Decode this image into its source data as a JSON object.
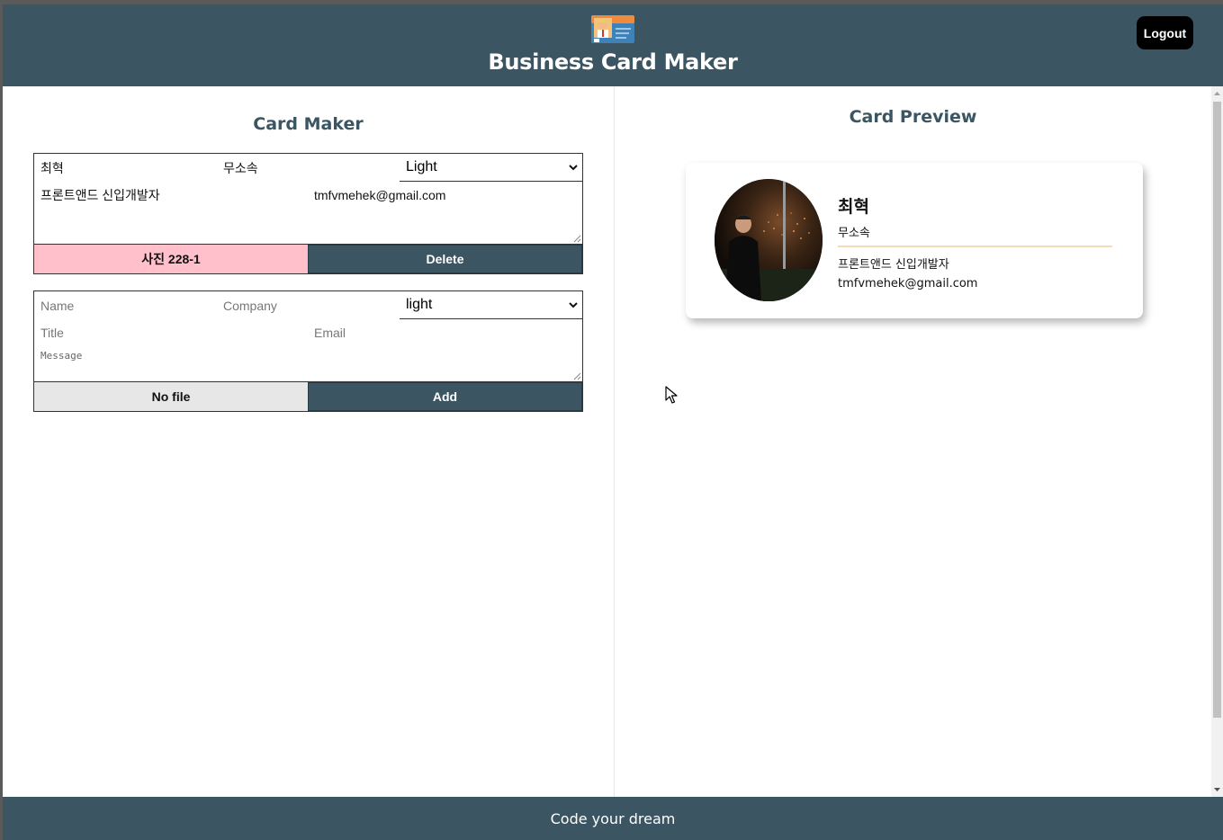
{
  "header": {
    "title": "Business Card Maker",
    "logout_label": "Logout",
    "logo_icon": "business-card-logo"
  },
  "maker": {
    "title": "Card Maker",
    "cards": [
      {
        "name": "최혁",
        "company": "무소속",
        "theme": "Light",
        "title": "프론트앤드 신입개발자",
        "email": "tmfvmehek@gmail.com",
        "message": "",
        "file_label": "사진 228-1",
        "action_label": "Delete"
      }
    ],
    "add_form": {
      "name_placeholder": "Name",
      "company_placeholder": "Company",
      "theme": "light",
      "title_placeholder": "Title",
      "email_placeholder": "Email",
      "message_placeholder": "Message",
      "file_label": "No file",
      "action_label": "Add"
    }
  },
  "preview": {
    "title": "Card Preview",
    "card": {
      "name": "최혁",
      "company": "무소속",
      "title": "프론트앤드 신입개발자",
      "email": "tmfvmehek@gmail.com"
    }
  },
  "footer": {
    "text": "Code your dream"
  },
  "colors": {
    "primary": "#3b5562",
    "file_selected": "#ffc0cb",
    "file_empty": "#e7e7e7",
    "divider_light": "#f3dcb6"
  }
}
